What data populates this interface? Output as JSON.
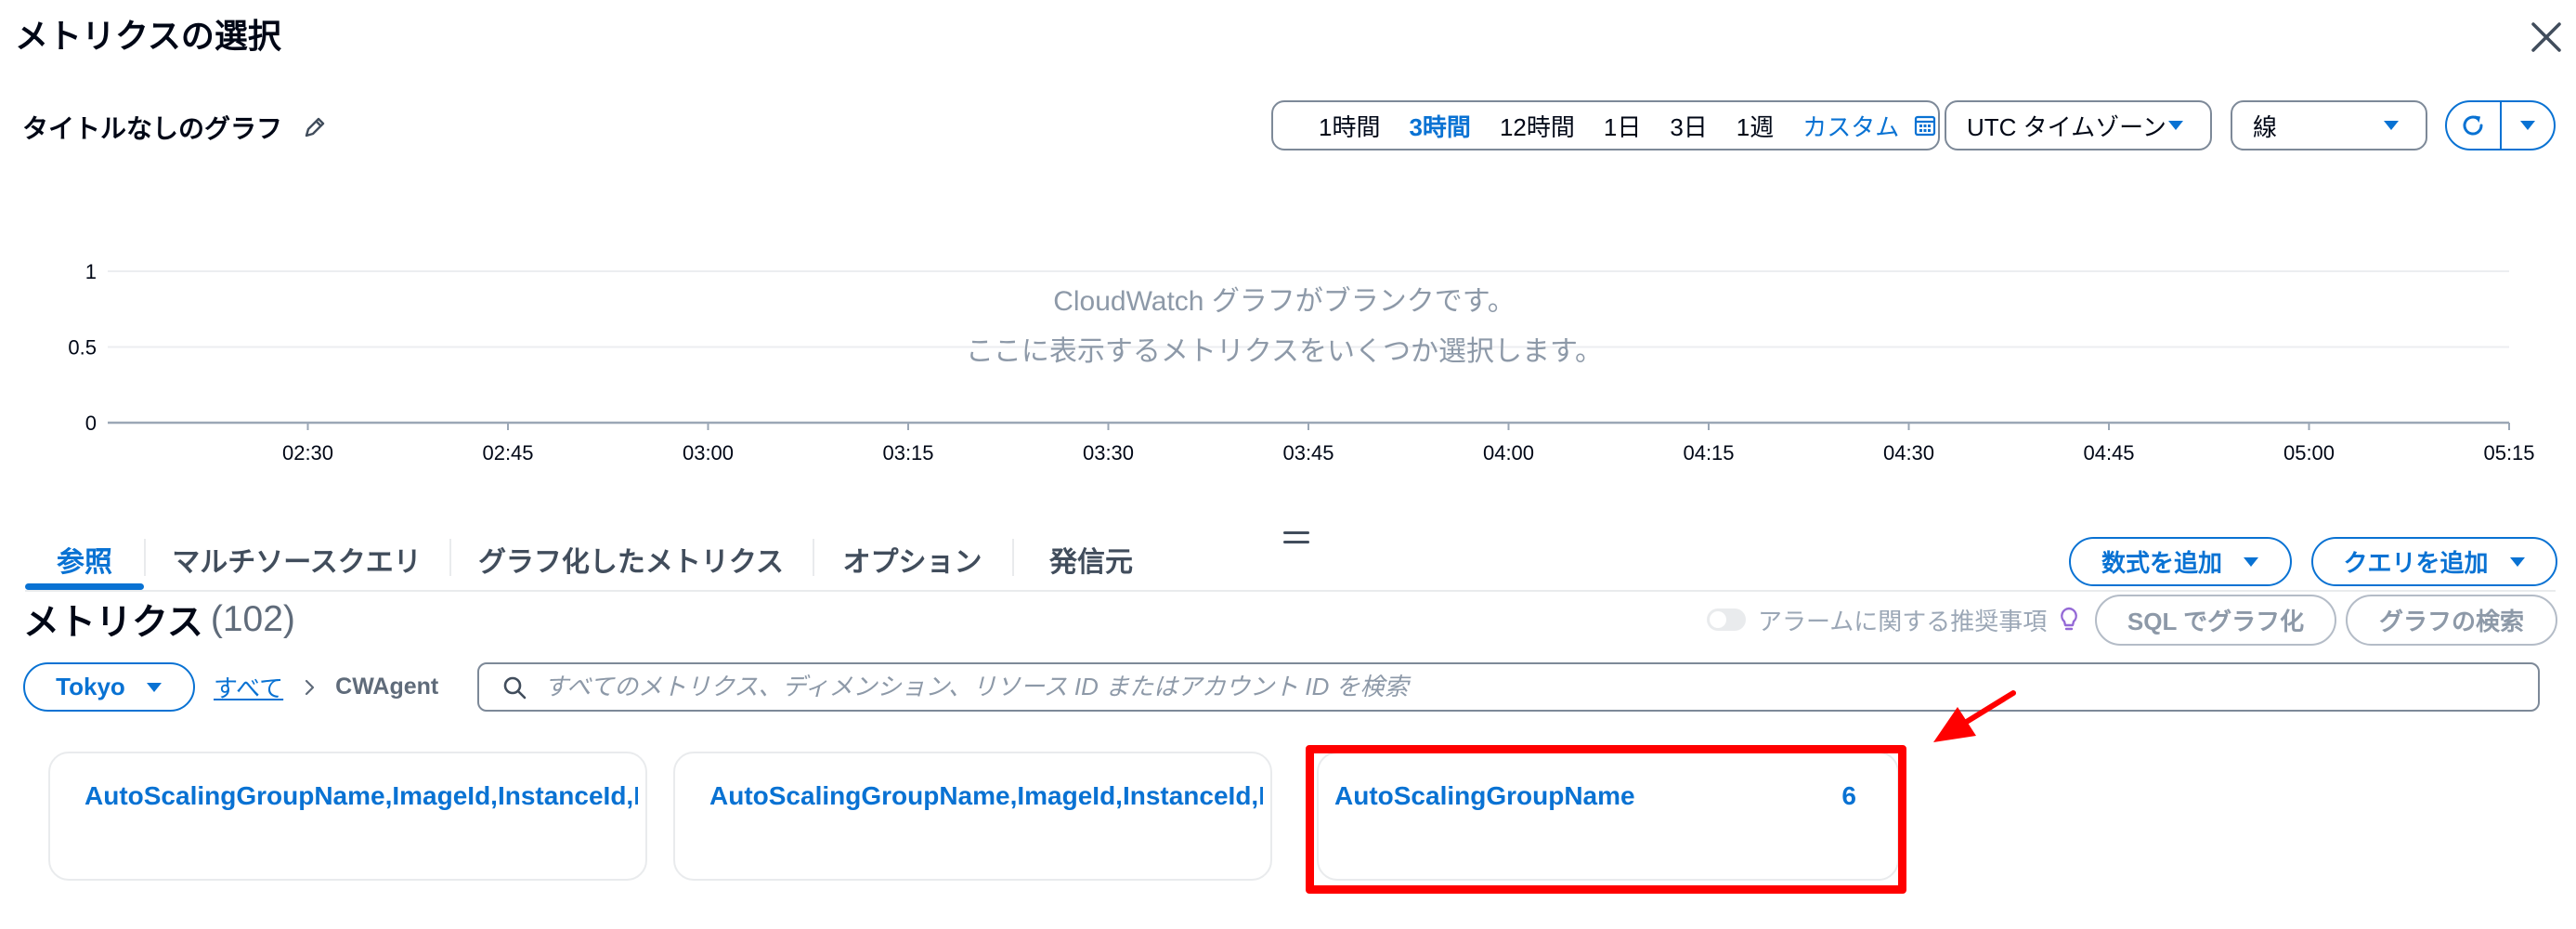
{
  "dialog": {
    "title": "メトリクスの選択"
  },
  "graph": {
    "title": "タイトルなしのグラフ",
    "blank_message": [
      "CloudWatch グラフがブランクです。",
      "ここに表示するメトリクスをいくつか選択します。"
    ],
    "y_ticks": [
      1,
      0.5,
      0
    ],
    "ylim": [
      0,
      1
    ],
    "x_ticks": [
      "02:30",
      "02:45",
      "03:00",
      "03:15",
      "03:30",
      "03:45",
      "04:00",
      "04:15",
      "04:30",
      "04:45",
      "05:00",
      "05:15"
    ]
  },
  "time_range": {
    "options": [
      "1時間",
      "3時間",
      "12時間",
      "1日",
      "3日",
      "1週"
    ],
    "selected_index": 1,
    "custom_label": "カスタム"
  },
  "timezone": {
    "value": "UTC タイムゾーン"
  },
  "chart_type": {
    "value": "線"
  },
  "tabs": [
    {
      "label": "参照"
    },
    {
      "label": "マルチソースクエリ"
    },
    {
      "label": "グラフ化したメトリクス"
    },
    {
      "label": "オプション"
    },
    {
      "label": "発信元"
    }
  ],
  "active_tab": 0,
  "actions": {
    "add_math": "数式を追加",
    "add_query": "クエリを追加"
  },
  "metrics": {
    "heading": "メトリクス",
    "count": "(102)",
    "alarm_toggle_label": "アラームに関する推奨事項",
    "alarm_toggle_on": false,
    "sql_button": "SQL でグラフ化",
    "graph_search_button": "グラフの検索"
  },
  "browse": {
    "region": "Tokyo",
    "breadcrumb": [
      "すべて",
      "CWAgent"
    ],
    "search_placeholder": "すべてのメトリクス、ディメンション、リソース ID またはアカウント ID を検索"
  },
  "namespace_cards": [
    {
      "label": "AutoScalingGroupName,ImageId,InstanceId,I"
    },
    {
      "label": "AutoScalingGroupName,ImageId,InstanceId,I"
    },
    {
      "label": "AutoScalingGroupName",
      "count": "6",
      "highlighted": true
    }
  ],
  "colors": {
    "accent": "#0972d3",
    "text": "#000716",
    "secondary": "#5f6b7a",
    "border": "#7d8998",
    "muted": "#8d99a8",
    "highlight": "#ff0000",
    "bulb": "#9469d6"
  },
  "icons": {
    "close": "close-icon",
    "edit": "pencil-icon",
    "calendar": "calendar-icon",
    "dropdown": "caret-down-icon",
    "refresh": "refresh-icon",
    "search": "search-icon",
    "breadcrumb_separator": "chevron-right-icon",
    "alarm_recommendation": "lightbulb-icon"
  }
}
